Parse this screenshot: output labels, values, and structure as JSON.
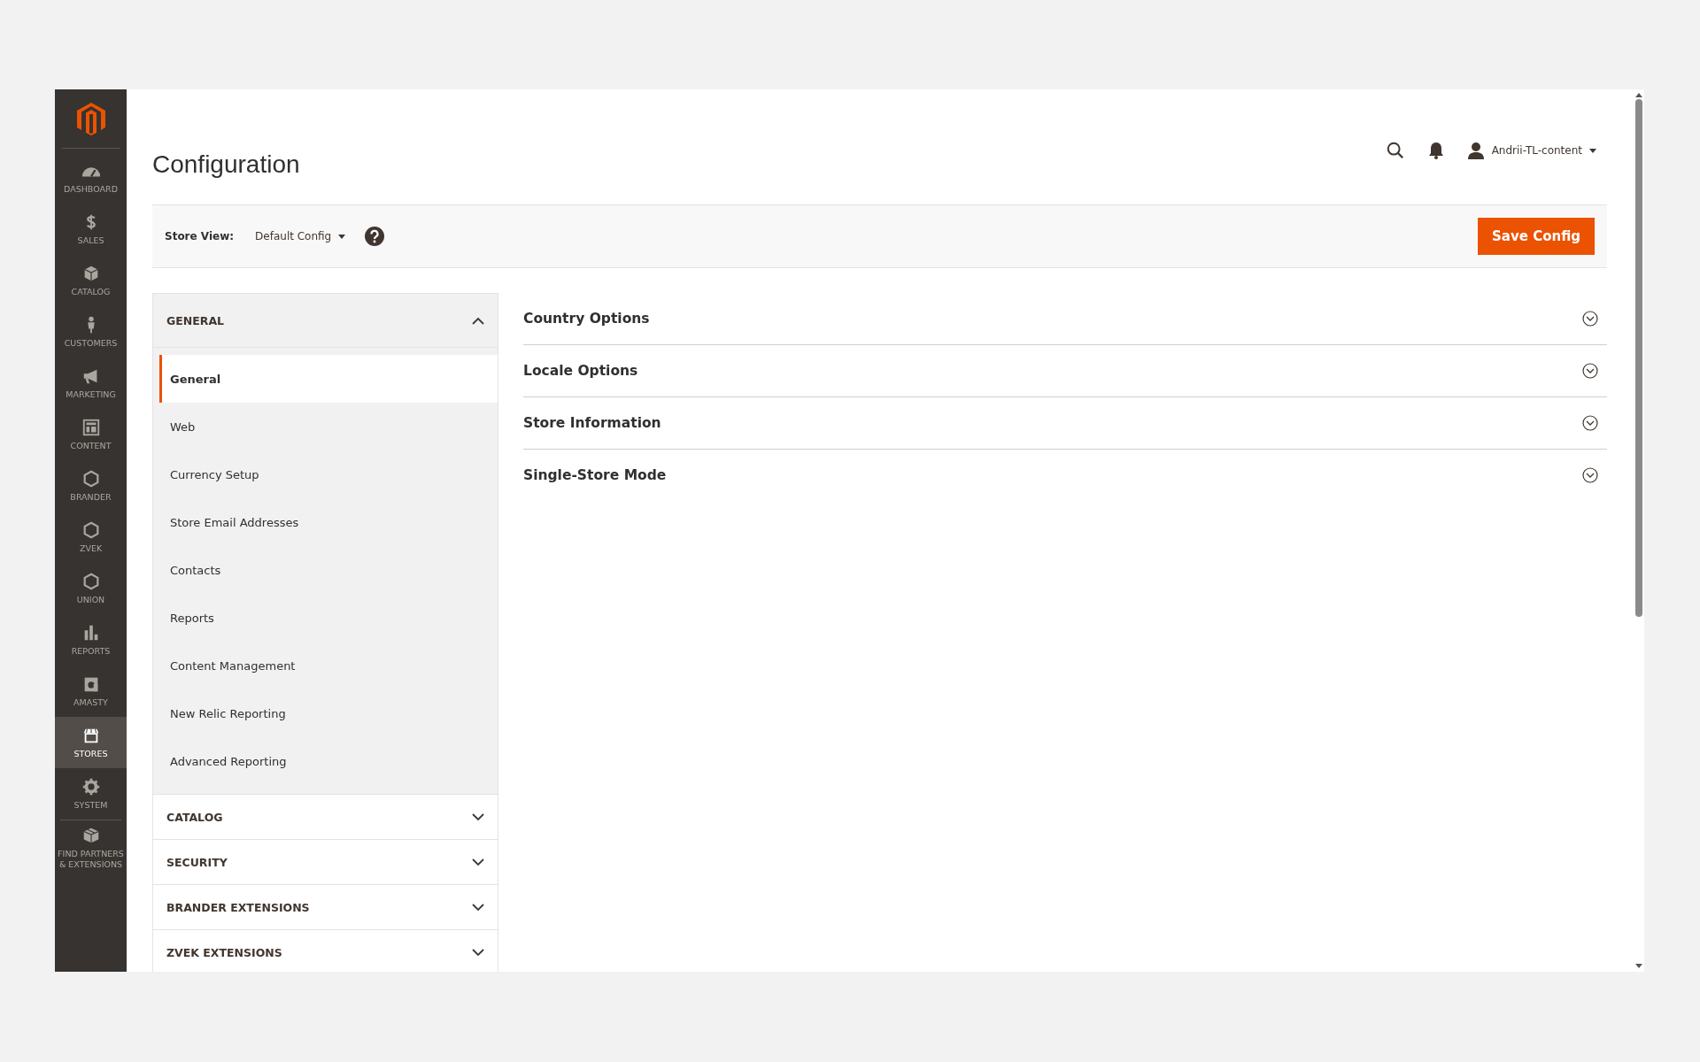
{
  "sidebar": {
    "items": [
      {
        "label": "DASHBOARD",
        "selected": false
      },
      {
        "label": "SALES",
        "selected": false
      },
      {
        "label": "CATALOG",
        "selected": false
      },
      {
        "label": "CUSTOMERS",
        "selected": false
      },
      {
        "label": "MARKETING",
        "selected": false
      },
      {
        "label": "CONTENT",
        "selected": false
      },
      {
        "label": "BRANDER",
        "selected": false
      },
      {
        "label": "ZVEK",
        "selected": false
      },
      {
        "label": "UNION",
        "selected": false
      },
      {
        "label": "REPORTS",
        "selected": false
      },
      {
        "label": "AMASTY",
        "selected": false
      },
      {
        "label": "STORES",
        "selected": true
      },
      {
        "label": "SYSTEM",
        "selected": false
      },
      {
        "label": "FIND PARTNERS & EXTENSIONS",
        "selected": false
      }
    ]
  },
  "header": {
    "title": "Configuration",
    "user": "Andrii-TL-content"
  },
  "scope": {
    "label": "Store View:",
    "value": "Default Config"
  },
  "save_button": "Save Config",
  "config_nav": [
    {
      "title": "GENERAL",
      "expanded": true,
      "items": [
        {
          "label": "General",
          "selected": true
        },
        {
          "label": "Web",
          "selected": false
        },
        {
          "label": "Currency Setup",
          "selected": false
        },
        {
          "label": "Store Email Addresses",
          "selected": false
        },
        {
          "label": "Contacts",
          "selected": false
        },
        {
          "label": "Reports",
          "selected": false
        },
        {
          "label": "Content Management",
          "selected": false
        },
        {
          "label": "New Relic Reporting",
          "selected": false
        },
        {
          "label": "Advanced Reporting",
          "selected": false
        }
      ]
    },
    {
      "title": "CATALOG",
      "expanded": false
    },
    {
      "title": "SECURITY",
      "expanded": false
    },
    {
      "title": "BRANDER EXTENSIONS",
      "expanded": false
    },
    {
      "title": "ZVEK EXTENSIONS",
      "expanded": false
    }
  ],
  "sections": [
    {
      "title": "Country Options",
      "expanded": false
    },
    {
      "title": "Locale Options",
      "expanded": false
    },
    {
      "title": "Store Information",
      "expanded": false
    },
    {
      "title": "Single-Store Mode",
      "expanded": false
    }
  ]
}
